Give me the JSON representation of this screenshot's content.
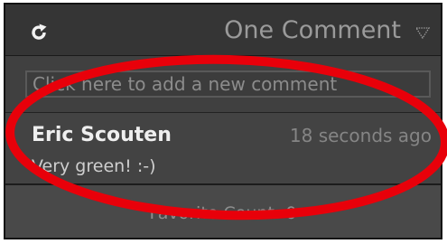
{
  "panel": {
    "title": "One Comment",
    "refresh_icon": "refresh-icon",
    "collapse_icon": "collapse-triangle-icon"
  },
  "new_comment": {
    "placeholder": "Click here to add a new comment"
  },
  "comments": [
    {
      "author": "Eric Scouten",
      "time": "18 seconds ago",
      "text": "Very green! :-)"
    }
  ],
  "favorite": {
    "label": "Favorite Count: 0"
  },
  "colors": {
    "panel_bg": "#2b2b2b",
    "annotation_red": "#e8000a"
  }
}
